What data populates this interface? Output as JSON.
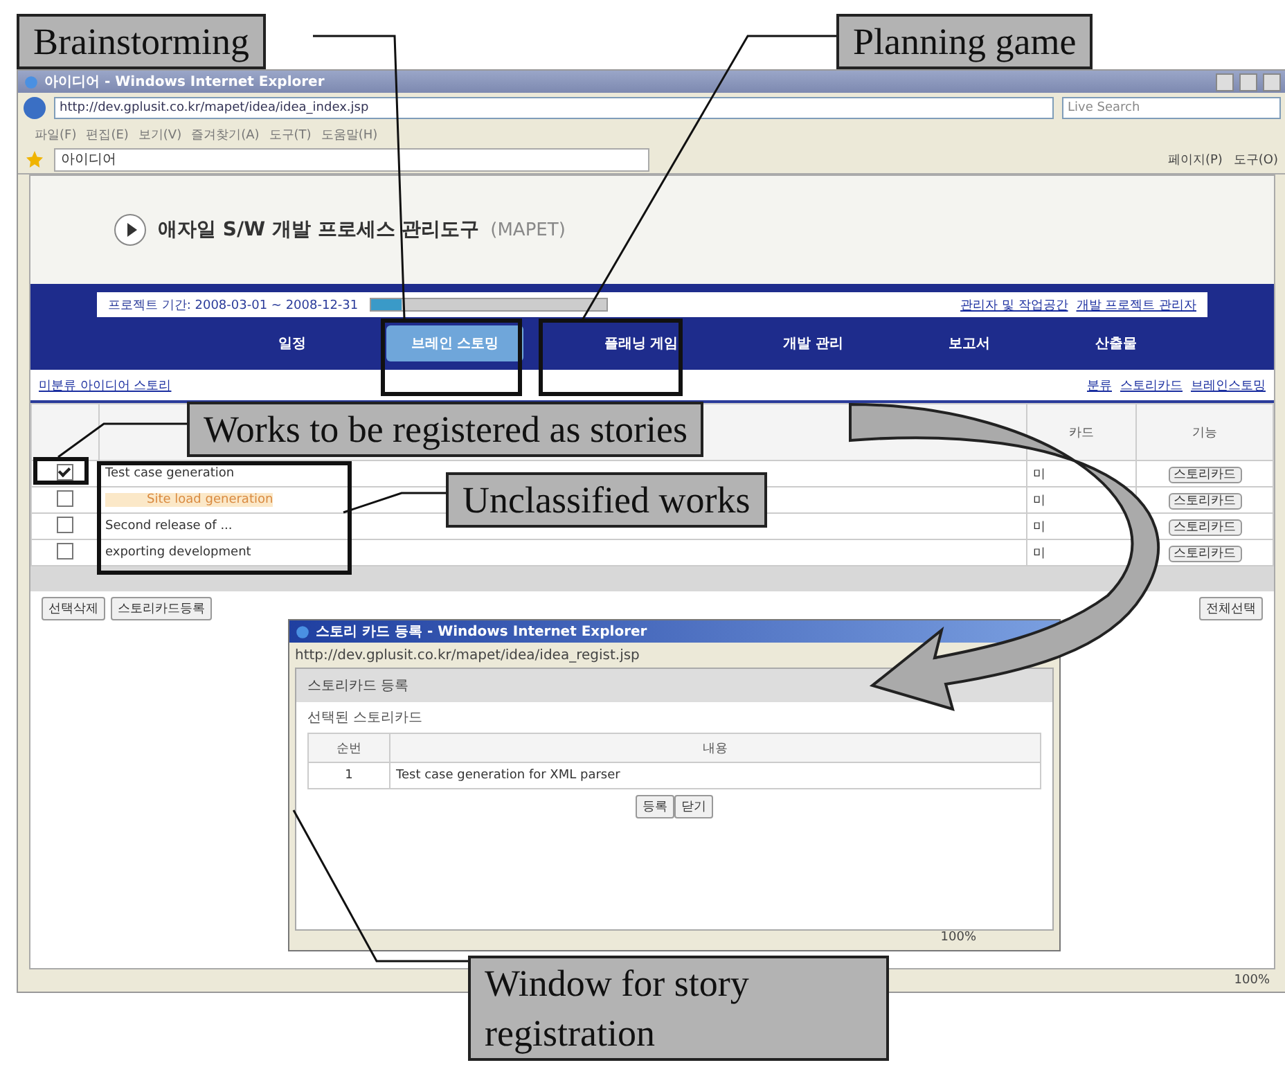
{
  "callouts": [
    {
      "text": "Brainstorming"
    },
    {
      "text": "Planning game"
    },
    {
      "text": "Works to be registered as stories"
    },
    {
      "text": "Unclassified works"
    },
    {
      "text": "Window for story registration"
    }
  ],
  "browser": {
    "title": "아이디어 - Windows Internet Explorer",
    "address": "http://dev.gplusit.co.kr/mapet/idea/idea_index.jsp",
    "search_placeholder": "Live Search",
    "menu": [
      "파일(F)",
      "편집(E)",
      "보기(V)",
      "즐겨찾기(A)",
      "도구(T)",
      "도움말(H)"
    ],
    "tab_title": "아이디어",
    "toolbar": [
      "페이지(P)",
      "도구(O)"
    ],
    "zoom": "100%"
  },
  "page": {
    "title": "애자일 S/W 개발 프로세스 관리도구",
    "title_suffix": "(MAPET)",
    "info": "프로젝트 기간: 2008-03-01 ~ 2008-12-31",
    "progress": {
      "level": 0.13
    },
    "info_links": [
      "관리자 및 작업공간",
      "개발 프로젝트 관리자"
    ],
    "nav": [
      {
        "label": "일정",
        "selected": false
      },
      {
        "label": "브레인 스토밍",
        "selected": true
      },
      {
        "label": "플래닝 게임",
        "selected": false
      },
      {
        "label": "개발 관리",
        "selected": false
      },
      {
        "label": "보고서",
        "selected": false
      },
      {
        "label": "산출물",
        "selected": false
      }
    ],
    "left_link": "미분류 아이디어 스토리",
    "right_links": [
      "분류",
      "스토리카드",
      "브레인스토밍"
    ],
    "columns": [
      "카드",
      "기능"
    ],
    "rows": [
      {
        "checked": true,
        "highlighted": false,
        "text": "Test case generation",
        "card": "미",
        "action": "스토리카드"
      },
      {
        "checked": false,
        "highlighted": true,
        "text": "Site load generation",
        "card": "미",
        "action": "스토리카드"
      },
      {
        "checked": false,
        "highlighted": false,
        "text": "Second release of ...",
        "card": "미",
        "action": "스토리카드"
      },
      {
        "checked": false,
        "highlighted": false,
        "text": "exporting development",
        "card": "미",
        "action": "스토리카드"
      }
    ],
    "buttons": [
      "선택삭제",
      "스토리카드등록"
    ],
    "right_button": "전체선택"
  },
  "popup": {
    "title": "스토리 카드 등록 - Windows Internet Explorer",
    "address": "http://dev.gplusit.co.kr/mapet/idea/idea_regist.jsp",
    "heading": "스토리카드 등록",
    "section": "선택된 스토리카드",
    "columns": [
      "순번",
      "내용"
    ],
    "rows": [
      {
        "no": "1",
        "content": "Test case generation for XML parser"
      }
    ],
    "buttons": [
      "등록",
      "닫기"
    ],
    "zoom": "100%"
  }
}
